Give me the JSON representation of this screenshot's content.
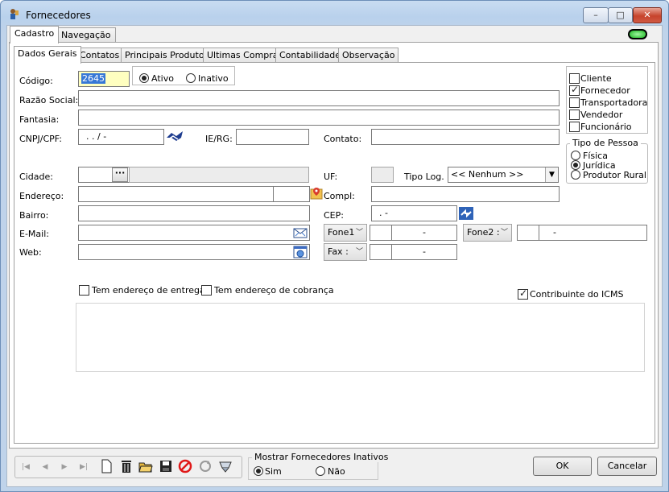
{
  "window": {
    "title": "Fornecedores",
    "minimize": "–",
    "maximize": "□",
    "close": "✕"
  },
  "outer_tabs": [
    "Cadastro",
    "Navegação"
  ],
  "inner_tabs": [
    "Dados Gerais",
    "Contatos",
    "Principais Produtos",
    "Ultimas Compras",
    "Contabilidade",
    "Observação"
  ],
  "form": {
    "codigo_label": "Código:",
    "codigo_value": "2645",
    "ativo_label": "Ativo",
    "inativo_label": "Inativo",
    "razao_label": "Razão Social:",
    "fantasia_label": "Fantasia:",
    "cnpj_label": "CNPJ/CPF:",
    "cnpj_mask": ".   .   /     -",
    "ierg_label": "IE/RG:",
    "contato_label": "Contato:",
    "cidade_label": "Cidade:",
    "cidade_btn": "···",
    "uf_label": "UF:",
    "tipolog_label": "Tipo Log. :",
    "tipolog_value": "<< Nenhum >>",
    "endereco_label": "Endereço:",
    "compl_label": "Compl:",
    "bairro_label": "Bairro:",
    "cep_label": "CEP:",
    "cep_mask": ".   -",
    "email_label": "E-Mail:",
    "web_label": "Web:",
    "fone1_label": "Fone1",
    "fone2_label": "Fone2 :",
    "fax_label": "Fax :",
    "phone_mask": "-",
    "entrega_label": "Tem endereço de entrega",
    "cobranca_label": "Tem endereço de cobrança",
    "icms_label": "Contribuinte do ICMS"
  },
  "roles": [
    {
      "label": "Cliente",
      "checked": false
    },
    {
      "label": "Fornecedor",
      "checked": true
    },
    {
      "label": "Transportadora",
      "checked": false
    },
    {
      "label": "Vendedor",
      "checked": false
    },
    {
      "label": "Funcionário",
      "checked": false
    }
  ],
  "tipo_pessoa": {
    "title": "Tipo de Pessoa",
    "options": [
      {
        "label": "Física",
        "selected": false
      },
      {
        "label": "Jurídica",
        "selected": true
      },
      {
        "label": "Produtor Rural",
        "selected": false
      }
    ]
  },
  "toolbar_icons": [
    "first-icon",
    "prev-icon",
    "next-icon",
    "last-icon",
    "new-icon",
    "delete-icon",
    "open-icon",
    "save-icon",
    "cancel-icon",
    "refresh-icon",
    "filter-icon"
  ],
  "inactive_group": {
    "title": "Mostrar Fornecedores Inativos",
    "sim": "Sim",
    "nao": "Não"
  },
  "buttons": {
    "ok": "OK",
    "cancelar": "Cancelar"
  },
  "colors": {
    "title_gradient": "#bfd3ea",
    "selected_code_bg": "#ffffc0",
    "led": "#18b41e"
  }
}
